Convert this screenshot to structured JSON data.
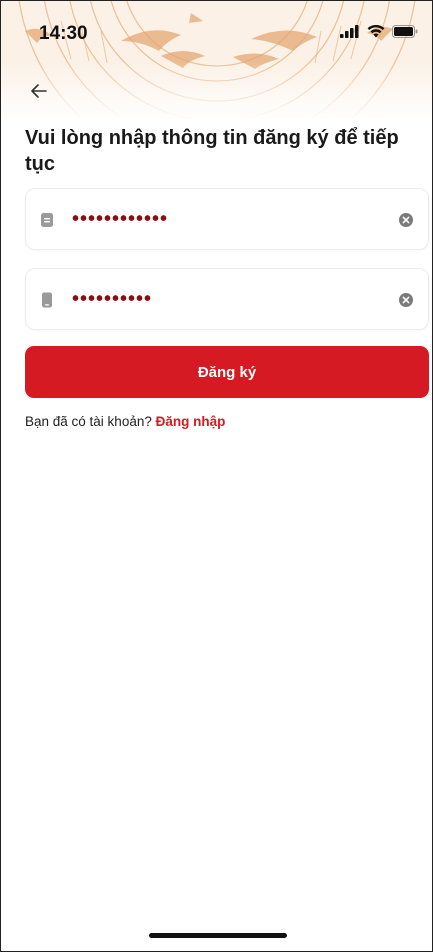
{
  "status_bar": {
    "time": "14:30",
    "icons": [
      "signal-icon",
      "wifi-icon",
      "battery-icon"
    ]
  },
  "nav": {
    "back_icon": "arrow-left-icon"
  },
  "title": "Vui lòng nhập thông tin đăng ký để tiếp tục",
  "form": {
    "field_1": {
      "masked_value": "••••••••••••",
      "lead_icon": "id-card-icon",
      "clear_icon": "clear-circle-icon"
    },
    "field_2": {
      "masked_value": "••••••••••",
      "lead_icon": "phone-icon",
      "clear_icon": "clear-circle-icon"
    },
    "submit_label": "Đăng ký"
  },
  "login_prompt": {
    "text": "Bạn đã có tài khoản? ",
    "link_label": "Đăng nhập"
  },
  "colors": {
    "brand_red": "#d61a23",
    "masked_text": "#8b1016",
    "header_pattern": "#e8b583"
  }
}
